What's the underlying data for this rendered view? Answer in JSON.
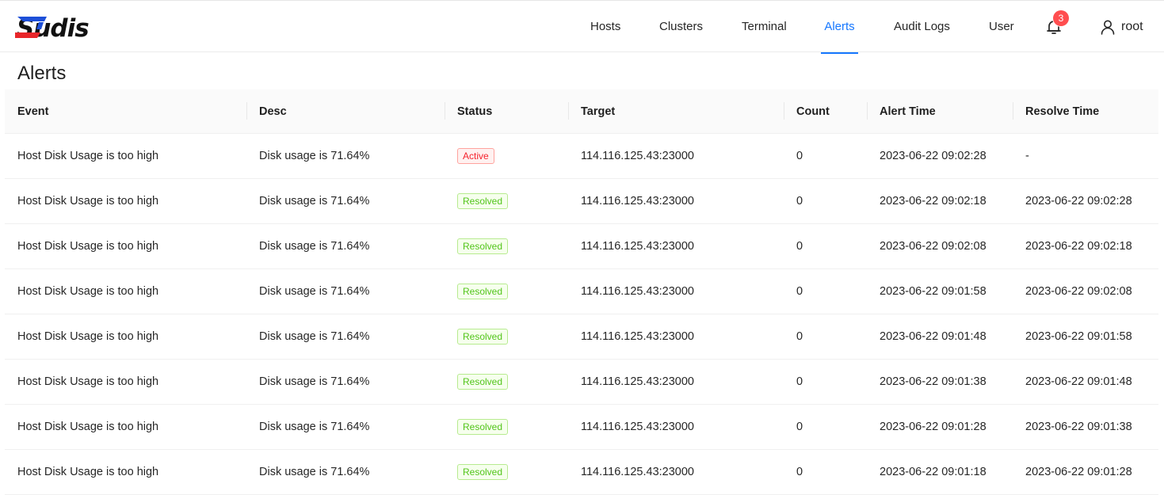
{
  "app": {
    "logo_text": "Sudis"
  },
  "nav": {
    "items": [
      {
        "label": "Hosts",
        "active": false
      },
      {
        "label": "Clusters",
        "active": false
      },
      {
        "label": "Terminal",
        "active": false
      },
      {
        "label": "Alerts",
        "active": true
      },
      {
        "label": "Audit Logs",
        "active": false
      },
      {
        "label": "User",
        "active": false
      }
    ],
    "notification_count": "3",
    "user_name": "root"
  },
  "page": {
    "title": "Alerts"
  },
  "table": {
    "columns": [
      "Event",
      "Desc",
      "Status",
      "Target",
      "Count",
      "Alert Time",
      "Resolve Time"
    ],
    "rows": [
      {
        "event": "Host Disk Usage is too high",
        "desc": "Disk usage is 71.64%",
        "status": "Active",
        "target": "114.116.125.43:23000",
        "count": "0",
        "alert_time": "2023-06-22 09:02:28",
        "resolve_time": "-"
      },
      {
        "event": "Host Disk Usage is too high",
        "desc": "Disk usage is 71.64%",
        "status": "Resolved",
        "target": "114.116.125.43:23000",
        "count": "0",
        "alert_time": "2023-06-22 09:02:18",
        "resolve_time": "2023-06-22 09:02:28"
      },
      {
        "event": "Host Disk Usage is too high",
        "desc": "Disk usage is 71.64%",
        "status": "Resolved",
        "target": "114.116.125.43:23000",
        "count": "0",
        "alert_time": "2023-06-22 09:02:08",
        "resolve_time": "2023-06-22 09:02:18"
      },
      {
        "event": "Host Disk Usage is too high",
        "desc": "Disk usage is 71.64%",
        "status": "Resolved",
        "target": "114.116.125.43:23000",
        "count": "0",
        "alert_time": "2023-06-22 09:01:58",
        "resolve_time": "2023-06-22 09:02:08"
      },
      {
        "event": "Host Disk Usage is too high",
        "desc": "Disk usage is 71.64%",
        "status": "Resolved",
        "target": "114.116.125.43:23000",
        "count": "0",
        "alert_time": "2023-06-22 09:01:48",
        "resolve_time": "2023-06-22 09:01:58"
      },
      {
        "event": "Host Disk Usage is too high",
        "desc": "Disk usage is 71.64%",
        "status": "Resolved",
        "target": "114.116.125.43:23000",
        "count": "0",
        "alert_time": "2023-06-22 09:01:38",
        "resolve_time": "2023-06-22 09:01:48"
      },
      {
        "event": "Host Disk Usage is too high",
        "desc": "Disk usage is 71.64%",
        "status": "Resolved",
        "target": "114.116.125.43:23000",
        "count": "0",
        "alert_time": "2023-06-22 09:01:28",
        "resolve_time": "2023-06-22 09:01:38"
      },
      {
        "event": "Host Disk Usage is too high",
        "desc": "Disk usage is 71.64%",
        "status": "Resolved",
        "target": "114.116.125.43:23000",
        "count": "0",
        "alert_time": "2023-06-22 09:01:18",
        "resolve_time": "2023-06-22 09:01:28"
      }
    ]
  },
  "colors": {
    "accent": "#1677ff",
    "badge": "#ff4d4f",
    "logo_blue": "#1d4fd8",
    "logo_red": "#e8262a",
    "status_active": "#f5222d",
    "status_resolved": "#52c41a"
  },
  "icons": {
    "bell": "bell-icon",
    "user": "user-icon"
  }
}
